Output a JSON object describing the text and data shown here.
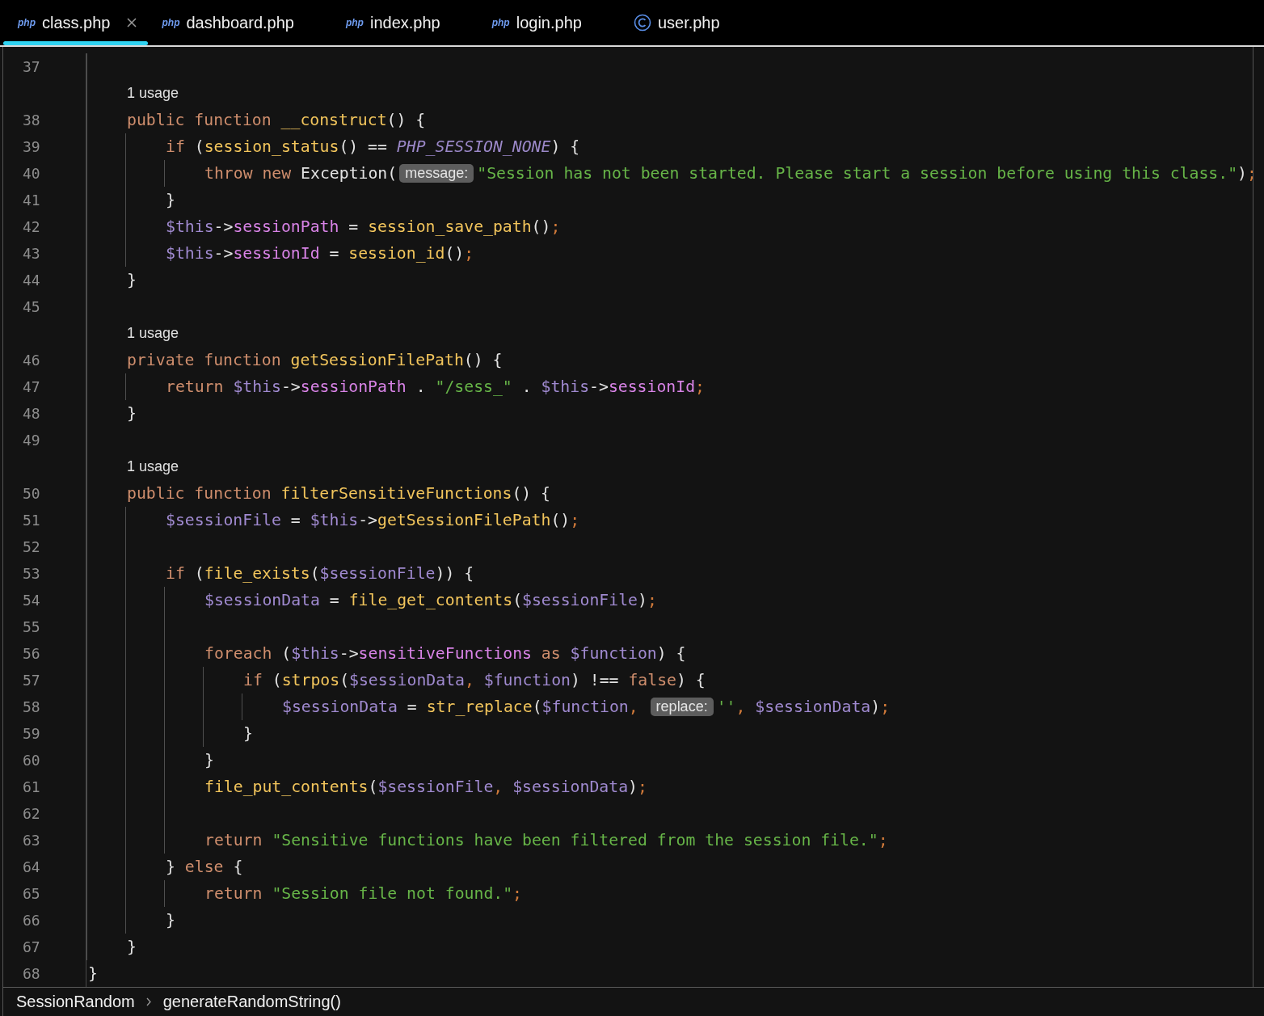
{
  "tabs": [
    {
      "label": "class.php",
      "kind": "script",
      "badge": "php",
      "selected": true
    },
    {
      "label": "dashboard.php",
      "kind": "script",
      "badge": "php",
      "selected": false
    },
    {
      "label": "index.php",
      "kind": "script",
      "badge": "php",
      "selected": false
    },
    {
      "label": "login.php",
      "kind": "script",
      "badge": "php",
      "selected": false
    },
    {
      "label": "user.php",
      "kind": "class",
      "selected": false
    }
  ],
  "code": [
    {
      "kind": "block",
      "children": [
        {
          "kind": "line",
          "number": "37"
        },
        {
          "kind": "usage",
          "text": "1 usage"
        },
        {
          "kind": "line",
          "number": "38",
          "tokens": [
            {
              "kind": "keyword",
              "text": "public function "
            },
            {
              "kind": "function",
              "text": "__construct"
            },
            {
              "kind": "plain",
              "text": "() {"
            }
          ]
        },
        {
          "kind": "block",
          "children": [
            {
              "kind": "line",
              "number": "39",
              "tokens": [
                {
                  "kind": "keyword",
                  "text": "if "
                },
                {
                  "kind": "plain",
                  "text": "("
                },
                {
                  "kind": "function",
                  "text": "session_status"
                },
                {
                  "kind": "plain",
                  "text": "() == "
                },
                {
                  "kind": "constant",
                  "text": "PHP_SESSION_NONE"
                },
                {
                  "kind": "plain",
                  "text": ") {"
                }
              ]
            },
            {
              "kind": "block",
              "children": [
                {
                  "kind": "line",
                  "number": "40",
                  "tokens": [
                    {
                      "kind": "keyword",
                      "text": "throw new "
                    },
                    {
                      "kind": "plain",
                      "text": "Exception("
                    },
                    {
                      "kind": "hint",
                      "text": "message:"
                    },
                    {
                      "kind": "string",
                      "text": "\"Session has not been started. Please start a session before using this class.\""
                    },
                    {
                      "kind": "plain",
                      "text": ")"
                    },
                    {
                      "kind": "punct",
                      "text": ";"
                    }
                  ]
                }
              ]
            },
            {
              "kind": "line",
              "number": "41",
              "tokens": [
                {
                  "kind": "plain",
                  "text": "}"
                }
              ]
            },
            {
              "kind": "line",
              "number": "42",
              "tokens": [
                {
                  "kind": "variable",
                  "text": "$this"
                },
                {
                  "kind": "plain",
                  "text": "->"
                },
                {
                  "kind": "property",
                  "text": "sessionPath"
                },
                {
                  "kind": "plain",
                  "text": " = "
                },
                {
                  "kind": "function",
                  "text": "session_save_path"
                },
                {
                  "kind": "plain",
                  "text": "()"
                },
                {
                  "kind": "punct",
                  "text": ";"
                }
              ]
            },
            {
              "kind": "line",
              "number": "43",
              "tokens": [
                {
                  "kind": "variable",
                  "text": "$this"
                },
                {
                  "kind": "plain",
                  "text": "->"
                },
                {
                  "kind": "property",
                  "text": "sessionId"
                },
                {
                  "kind": "plain",
                  "text": " = "
                },
                {
                  "kind": "function",
                  "text": "session_id"
                },
                {
                  "kind": "plain",
                  "text": "()"
                },
                {
                  "kind": "punct",
                  "text": ";"
                }
              ]
            }
          ]
        },
        {
          "kind": "line",
          "number": "44",
          "tokens": [
            {
              "kind": "plain",
              "text": "}"
            }
          ]
        },
        {
          "kind": "line",
          "number": "45"
        },
        {
          "kind": "usage",
          "text": "1 usage"
        },
        {
          "kind": "line",
          "number": "46",
          "tokens": [
            {
              "kind": "keyword",
              "text": "private function "
            },
            {
              "kind": "function",
              "text": "getSessionFilePath"
            },
            {
              "kind": "plain",
              "text": "() {"
            }
          ]
        },
        {
          "kind": "block",
          "children": [
            {
              "kind": "line",
              "number": "47",
              "tokens": [
                {
                  "kind": "keyword",
                  "text": "return "
                },
                {
                  "kind": "variable",
                  "text": "$this"
                },
                {
                  "kind": "plain",
                  "text": "->"
                },
                {
                  "kind": "property",
                  "text": "sessionPath"
                },
                {
                  "kind": "plain",
                  "text": " . "
                },
                {
                  "kind": "string",
                  "text": "\"/sess_\""
                },
                {
                  "kind": "plain",
                  "text": " . "
                },
                {
                  "kind": "variable",
                  "text": "$this"
                },
                {
                  "kind": "plain",
                  "text": "->"
                },
                {
                  "kind": "property",
                  "text": "sessionId"
                },
                {
                  "kind": "punct",
                  "text": ";"
                }
              ]
            }
          ]
        },
        {
          "kind": "line",
          "number": "48",
          "tokens": [
            {
              "kind": "plain",
              "text": "}"
            }
          ]
        },
        {
          "kind": "line",
          "number": "49"
        },
        {
          "kind": "usage",
          "text": "1 usage"
        },
        {
          "kind": "line",
          "number": "50",
          "tokens": [
            {
              "kind": "keyword",
              "text": "public function "
            },
            {
              "kind": "function",
              "text": "filterSensitiveFunctions"
            },
            {
              "kind": "plain",
              "text": "() {"
            }
          ]
        },
        {
          "kind": "block",
          "children": [
            {
              "kind": "line",
              "number": "51",
              "tokens": [
                {
                  "kind": "variable",
                  "text": "$sessionFile"
                },
                {
                  "kind": "plain",
                  "text": " = "
                },
                {
                  "kind": "variable",
                  "text": "$this"
                },
                {
                  "kind": "plain",
                  "text": "->"
                },
                {
                  "kind": "function",
                  "text": "getSessionFilePath"
                },
                {
                  "kind": "plain",
                  "text": "()"
                },
                {
                  "kind": "punct",
                  "text": ";"
                }
              ]
            },
            {
              "kind": "line",
              "number": "52"
            },
            {
              "kind": "line",
              "number": "53",
              "tokens": [
                {
                  "kind": "keyword",
                  "text": "if "
                },
                {
                  "kind": "plain",
                  "text": "("
                },
                {
                  "kind": "function",
                  "text": "file_exists"
                },
                {
                  "kind": "plain",
                  "text": "("
                },
                {
                  "kind": "variable",
                  "text": "$sessionFile"
                },
                {
                  "kind": "plain",
                  "text": ")) {"
                }
              ]
            },
            {
              "kind": "block",
              "children": [
                {
                  "kind": "line",
                  "number": "54",
                  "tokens": [
                    {
                      "kind": "variable",
                      "text": "$sessionData"
                    },
                    {
                      "kind": "plain",
                      "text": " = "
                    },
                    {
                      "kind": "function",
                      "text": "file_get_contents"
                    },
                    {
                      "kind": "plain",
                      "text": "("
                    },
                    {
                      "kind": "variable",
                      "text": "$sessionFile"
                    },
                    {
                      "kind": "plain",
                      "text": ")"
                    },
                    {
                      "kind": "punct",
                      "text": ";"
                    }
                  ]
                },
                {
                  "kind": "line",
                  "number": "55"
                },
                {
                  "kind": "line",
                  "number": "56",
                  "tokens": [
                    {
                      "kind": "keyword",
                      "text": "foreach "
                    },
                    {
                      "kind": "plain",
                      "text": "("
                    },
                    {
                      "kind": "variable",
                      "text": "$this"
                    },
                    {
                      "kind": "plain",
                      "text": "->"
                    },
                    {
                      "kind": "property",
                      "text": "sensitiveFunctions"
                    },
                    {
                      "kind": "keyword",
                      "text": " as "
                    },
                    {
                      "kind": "variable",
                      "text": "$function"
                    },
                    {
                      "kind": "plain",
                      "text": ") {"
                    }
                  ]
                },
                {
                  "kind": "block",
                  "children": [
                    {
                      "kind": "line",
                      "number": "57",
                      "tokens": [
                        {
                          "kind": "keyword",
                          "text": "if "
                        },
                        {
                          "kind": "plain",
                          "text": "("
                        },
                        {
                          "kind": "function",
                          "text": "strpos"
                        },
                        {
                          "kind": "plain",
                          "text": "("
                        },
                        {
                          "kind": "variable",
                          "text": "$sessionData"
                        },
                        {
                          "kind": "punct",
                          "text": ", "
                        },
                        {
                          "kind": "variable",
                          "text": "$function"
                        },
                        {
                          "kind": "plain",
                          "text": ") !== "
                        },
                        {
                          "kind": "keyword",
                          "text": "false"
                        },
                        {
                          "kind": "plain",
                          "text": ") {"
                        }
                      ]
                    },
                    {
                      "kind": "block",
                      "children": [
                        {
                          "kind": "line",
                          "number": "58",
                          "tokens": [
                            {
                              "kind": "variable",
                              "text": "$sessionData"
                            },
                            {
                              "kind": "plain",
                              "text": " = "
                            },
                            {
                              "kind": "function",
                              "text": "str_replace"
                            },
                            {
                              "kind": "plain",
                              "text": "("
                            },
                            {
                              "kind": "variable",
                              "text": "$function"
                            },
                            {
                              "kind": "punct",
                              "text": ", "
                            },
                            {
                              "kind": "hint",
                              "text": "replace:"
                            },
                            {
                              "kind": "string",
                              "text": "''"
                            },
                            {
                              "kind": "punct",
                              "text": ", "
                            },
                            {
                              "kind": "variable",
                              "text": "$sessionData"
                            },
                            {
                              "kind": "plain",
                              "text": ")"
                            },
                            {
                              "kind": "punct",
                              "text": ";"
                            }
                          ]
                        }
                      ]
                    },
                    {
                      "kind": "line",
                      "number": "59",
                      "tokens": [
                        {
                          "kind": "plain",
                          "text": "}"
                        }
                      ]
                    }
                  ]
                },
                {
                  "kind": "line",
                  "number": "60",
                  "tokens": [
                    {
                      "kind": "plain",
                      "text": "}"
                    }
                  ]
                },
                {
                  "kind": "line",
                  "number": "61",
                  "tokens": [
                    {
                      "kind": "function",
                      "text": "file_put_contents"
                    },
                    {
                      "kind": "plain",
                      "text": "("
                    },
                    {
                      "kind": "variable",
                      "text": "$sessionFile"
                    },
                    {
                      "kind": "punct",
                      "text": ", "
                    },
                    {
                      "kind": "variable",
                      "text": "$sessionData"
                    },
                    {
                      "kind": "plain",
                      "text": ")"
                    },
                    {
                      "kind": "punct",
                      "text": ";"
                    }
                  ]
                },
                {
                  "kind": "line",
                  "number": "62"
                },
                {
                  "kind": "line",
                  "number": "63",
                  "tokens": [
                    {
                      "kind": "keyword",
                      "text": "return "
                    },
                    {
                      "kind": "string",
                      "text": "\"Sensitive functions have been filtered from the session file.\""
                    },
                    {
                      "kind": "punct",
                      "text": ";"
                    }
                  ]
                }
              ]
            },
            {
              "kind": "line",
              "number": "64",
              "tokens": [
                {
                  "kind": "plain",
                  "text": "} "
                },
                {
                  "kind": "keyword",
                  "text": "else "
                },
                {
                  "kind": "plain",
                  "text": "{"
                }
              ]
            },
            {
              "kind": "block",
              "children": [
                {
                  "kind": "line",
                  "number": "65",
                  "tokens": [
                    {
                      "kind": "keyword",
                      "text": "return "
                    },
                    {
                      "kind": "string",
                      "text": "\"Session file not found.\""
                    },
                    {
                      "kind": "punct",
                      "text": ";"
                    }
                  ]
                }
              ]
            },
            {
              "kind": "line",
              "number": "66",
              "tokens": [
                {
                  "kind": "plain",
                  "text": "}"
                }
              ]
            }
          ]
        },
        {
          "kind": "line",
          "number": "67",
          "tokens": [
            {
              "kind": "plain",
              "text": "}"
            }
          ]
        }
      ]
    },
    {
      "kind": "line",
      "number": "68",
      "tokens": [
        {
          "kind": "plain",
          "text": "}"
        }
      ]
    }
  ],
  "breadcrumb": [
    "SessionRandom",
    "generateRandomString()"
  ]
}
